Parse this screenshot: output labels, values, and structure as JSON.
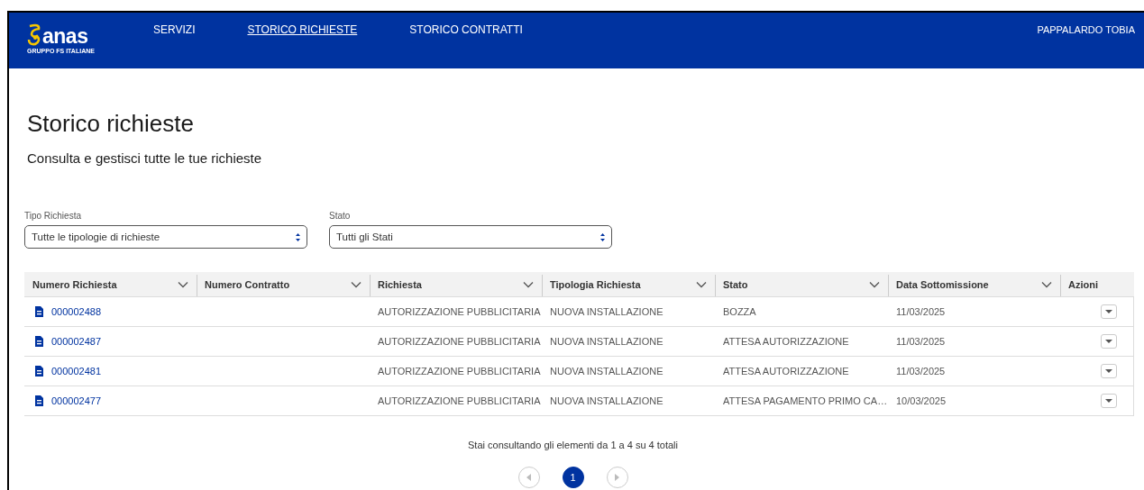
{
  "header": {
    "logo": {
      "name": "anas",
      "tagline": "GRUPPO FS ITALIANE"
    },
    "nav": [
      {
        "label": "SERVIZI",
        "selected": false
      },
      {
        "label": "STORICO RICHIESTE",
        "selected": true
      },
      {
        "label": "STORICO CONTRATTI",
        "selected": false
      }
    ],
    "user": "PAPPALARDO TOBIA"
  },
  "page": {
    "title": "Storico richieste",
    "subtitle": "Consulta e gestisci tutte le tue richieste"
  },
  "filters": [
    {
      "label": "Tipo Richiesta",
      "value": "Tutte le tipologie di richieste"
    },
    {
      "label": "Stato",
      "value": "Tutti gli Stati"
    }
  ],
  "table": {
    "columns": [
      {
        "label": "Numero Richiesta",
        "sortable": true
      },
      {
        "label": "Numero Contratto",
        "sortable": true
      },
      {
        "label": "Richiesta",
        "sortable": true
      },
      {
        "label": "Tipologia Richiesta",
        "sortable": true
      },
      {
        "label": "Stato",
        "sortable": true
      },
      {
        "label": "Data Sottomissione",
        "sortable": true
      },
      {
        "label": "Azioni",
        "sortable": false
      }
    ],
    "rows": [
      {
        "numero_richiesta": "000002488",
        "richiesta": "AUTORIZZAZIONE PUBBLICITARIA",
        "tipologia_richiesta": "NUOVA INSTALLAZIONE",
        "stato": "BOZZA",
        "data_sottomissione": "11/03/2025"
      },
      {
        "numero_richiesta": "000002487",
        "richiesta": "AUTORIZZAZIONE PUBBLICITARIA",
        "tipologia_richiesta": "NUOVA INSTALLAZIONE",
        "stato": "ATTESA AUTORIZZAZIONE",
        "data_sottomissione": "11/03/2025"
      },
      {
        "numero_richiesta": "000002481",
        "richiesta": "AUTORIZZAZIONE PUBBLICITARIA",
        "tipologia_richiesta": "NUOVA INSTALLAZIONE",
        "stato": "ATTESA AUTORIZZAZIONE",
        "data_sottomissione": "11/03/2025"
      },
      {
        "numero_richiesta": "000002477",
        "richiesta": "AUTORIZZAZIONE PUBBLICITARIA",
        "tipologia_richiesta": "NUOVA INSTALLAZIONE",
        "stato": "ATTESA PAGAMENTO PRIMO CA…",
        "data_sottomissione": "10/03/2025"
      }
    ]
  },
  "pagination": {
    "summary": "Stai consultando gli elementi da 1 a 4 su 4 totali",
    "pages": [
      {
        "label": "1",
        "selected": true
      }
    ]
  }
}
